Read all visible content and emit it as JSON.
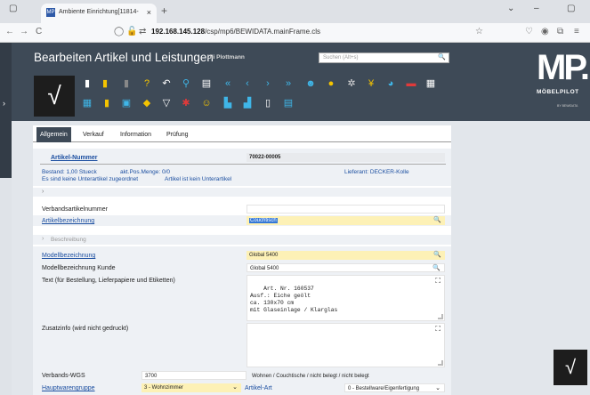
{
  "browser": {
    "tab_title": "Ambiente Einrichtung[11814-",
    "tab_favicon": "MP",
    "tab_close": "×",
    "new_tab": "+",
    "url_host": "192.168.145.128",
    "url_path": "/csp/mp6/BEWIDATA.mainFrame.cls",
    "nav_icons": [
      "back-icon",
      "forward-icon",
      "reload-icon"
    ]
  },
  "app": {
    "title": "Bearbeiten Artikel und Leistungen",
    "user": "Uli Plottmann",
    "search_placeholder": "Suchen (Alt+s)",
    "confirm_symbol": "√",
    "logo_text": "MP.",
    "logo_name": "MÖBELPILOT",
    "logo_sub": "BY BEWIDATA"
  },
  "tabs": [
    {
      "label": "Allgemein",
      "active": true
    },
    {
      "label": "Verkauf",
      "active": false
    },
    {
      "label": "Information",
      "active": false
    },
    {
      "label": "Prüfung",
      "active": false
    }
  ],
  "article": {
    "number_label": "Artikel-Nummer",
    "number_value": "70022-00005",
    "bestand": "Bestand: 1,00 Stueck",
    "akt_pos": "akt.Pos.Menge: 0/0",
    "lieferant": "Lieferant: DECKER-Kolle",
    "unterartikel_none": "Es sind keine Unterartikel zugeordnet",
    "kein_unterartikel": "Artikel ist kein Unterartikel"
  },
  "fields": {
    "verbandsartikelnummer_label": "Verbandsartikelnummer",
    "verbandsartikelnummer_value": "",
    "artikelbezeichnung_label": "Artikelbezeichnung",
    "artikelbezeichnung_value": "Couchtisch",
    "beschreibung_label": "Beschreibung",
    "modellbezeichnung_label": "Modellbezeichnung",
    "modellbezeichnung_value": "Global 5400",
    "modellbezeichnung_kunde_label": "Modellbezeichnung Kunde",
    "modellbezeichnung_kunde_value": "Global 5400",
    "text_label": "Text (für Bestellung, Lieferpapiere und Etiketten)",
    "text_value": "Art. Nr. 160537\nAusf.: Eiche geölt\nca. 130x70 cm\nmit Glaseinlage / Klarglas",
    "zusatzinfo_label": "Zusatzinfo (wird nicht gedruckt)",
    "zusatzinfo_value": "",
    "verbands_wgs_label": "Verbands-WGS",
    "verbands_wgs_value": "3700",
    "verbands_wgs_desc": "Wohnen / Couchtische / nicht belegt / nicht belegt",
    "hauptwarengruppe_label": "Hauptwarengruppe",
    "hauptwarengruppe_value": "3 - Wohnzimmer",
    "artikel_art_label": "Artikel-Art",
    "artikel_art_value": "0 - Bestellware/Eigenfertigung"
  },
  "colors": {
    "header_bg": "#3e4a57",
    "accent_blue": "#1b4ea0",
    "field_yellow": "#fdf1b6",
    "selection": "#3477d6"
  }
}
